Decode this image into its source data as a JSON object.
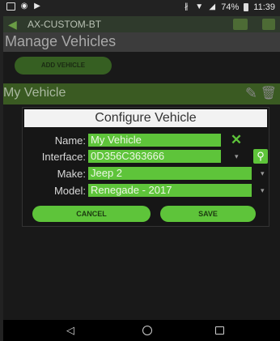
{
  "status_bar": {
    "battery": "74%",
    "time": "11:39",
    "icons": [
      "notification-box-icon",
      "circle-icon",
      "play-icon",
      "bluetooth-icon",
      "wifi-icon",
      "signal-icon",
      "battery-icon"
    ]
  },
  "app_bar": {
    "title": "AX-CUSTOM-BT",
    "icons": [
      "back-arrow-icon",
      "vehicle-icon",
      "vehicle-icon"
    ]
  },
  "page": {
    "title": "Manage Vehicles",
    "add_vehicle_label": "ADD VEHICLE",
    "vehicle_name": "My Vehicle"
  },
  "dialog": {
    "title": "Configure Vehicle",
    "fields": [
      {
        "label": "Name:",
        "value": "My Vehicle"
      },
      {
        "label": "Interface:",
        "value": "0D356C363666"
      },
      {
        "label": "Make:",
        "value": "Jeep 2"
      },
      {
        "label": "Model:",
        "value": "Renegade - 2017"
      }
    ],
    "cancel_label": "CANCEL",
    "save_label": "SAVE"
  },
  "nav_bar": {
    "icons": [
      "back-triangle-icon",
      "home-circle-icon",
      "recents-square-icon"
    ]
  },
  "colors": {
    "accent_green": "#5ec43a",
    "dim_green": "#3a5a22",
    "dialog_bg": "#161616"
  }
}
